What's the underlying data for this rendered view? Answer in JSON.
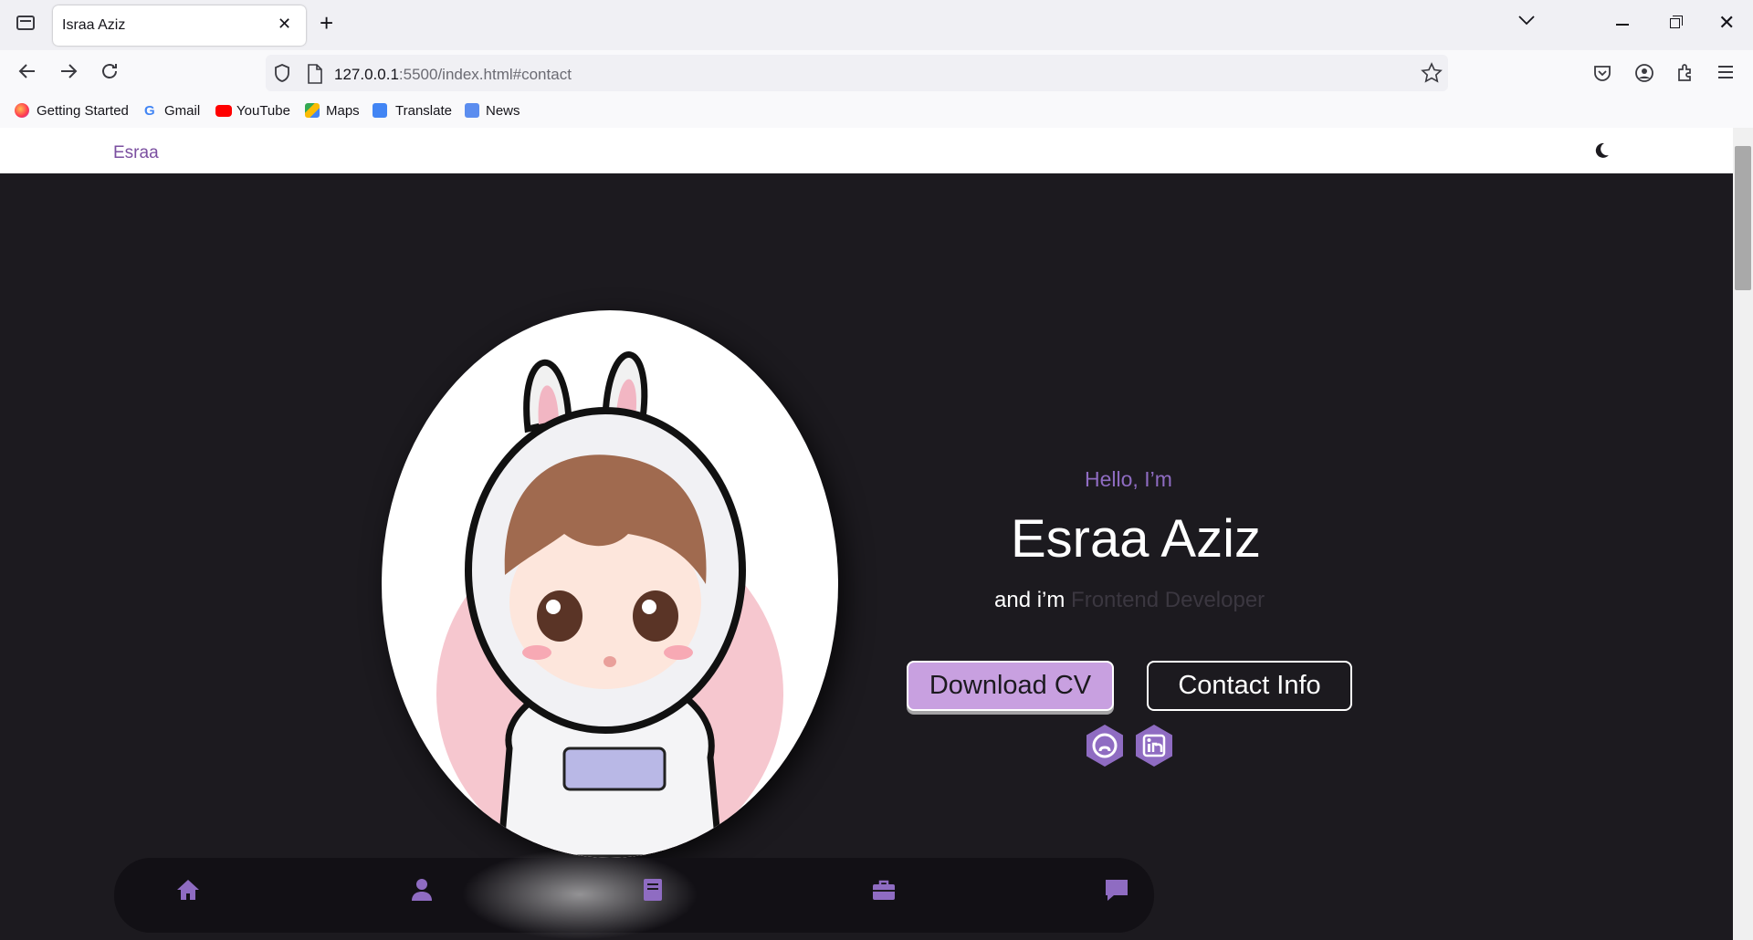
{
  "browser": {
    "tab_title": "Israa Aziz",
    "url_host": "127.0.0.1",
    "url_rest": ":5500/index.html#contact",
    "bookmarks": [
      {
        "label": "Getting Started"
      },
      {
        "label": "Gmail"
      },
      {
        "label": "YouTube"
      },
      {
        "label": "Maps"
      },
      {
        "label": "Translate"
      },
      {
        "label": "News"
      }
    ]
  },
  "page": {
    "brand": "Esraa",
    "hello": "Hello, I’m",
    "name": "Esraa Aziz",
    "role_prefix": "and i’m ",
    "role": "Frontend Developer",
    "download_label": "Download CV",
    "contact_label": "Contact Info",
    "accent": "#8f6cc2",
    "button_fill": "#c8a0e0",
    "background": "#1c1a1f"
  }
}
